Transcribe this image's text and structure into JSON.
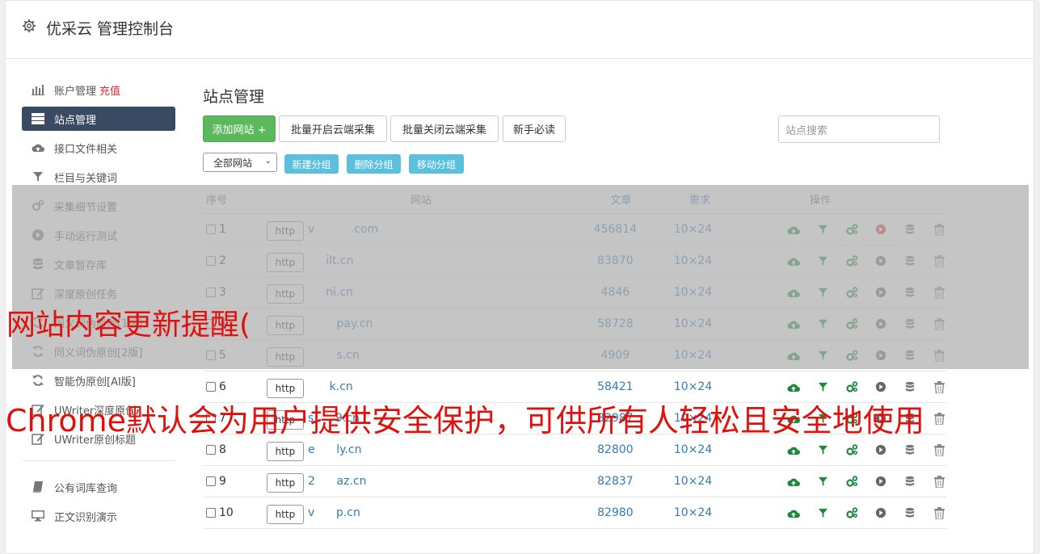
{
  "header": {
    "title": "优采云 管理控制台"
  },
  "sidebar": {
    "items": [
      {
        "icon": "bar-chart-icon",
        "label": "账户管理",
        "extra": "充值"
      },
      {
        "icon": "server-icon",
        "label": "站点管理",
        "active": true
      },
      {
        "icon": "cloud-upload-icon",
        "label": "接口文件相关"
      },
      {
        "icon": "filter-icon",
        "label": "栏目与关键词"
      },
      {
        "icon": "cogs-icon",
        "label": "采集细节设置"
      },
      {
        "icon": "play-circle-icon",
        "label": "手动运行测试"
      },
      {
        "icon": "database-icon",
        "label": "文章暂存库"
      },
      {
        "icon": "edit-icon",
        "label": "深度原创任务"
      },
      {
        "icon": "refresh-icon",
        "label": "同义词伪原创[1版]"
      },
      {
        "icon": "refresh-icon",
        "label": "同义词伪原创[2版]"
      },
      {
        "icon": "refresh-icon",
        "label": "智能伪原创[AI版]"
      },
      {
        "icon": "edit-icon",
        "label": "UWriter深度原创"
      },
      {
        "icon": "edit-icon",
        "label": "UWriter原创标题"
      }
    ],
    "items_after_divider": [
      {
        "icon": "book-icon",
        "label": "公有词库查询"
      },
      {
        "icon": "monitor-icon",
        "label": "正文识别演示"
      }
    ]
  },
  "main": {
    "title": "站点管理",
    "add_site_label": "添加网站 +",
    "batch_enable_label": "批量开启云端采集",
    "batch_disable_label": "批量关闭云端采集",
    "newbie_label": "新手必读",
    "search_placeholder": "站点搜索",
    "group_select": "全部网站",
    "new_group_label": "新建分组",
    "delete_group_label": "删除分组",
    "move_group_label": "移动分组",
    "table": {
      "headers": {
        "idx": "序号",
        "site": "网站",
        "articles": "文章",
        "demand": "需求",
        "ops": "操作"
      },
      "rows": [
        {
          "idx": "1",
          "proto": "http",
          "site": "v          .com",
          "articles": "456814",
          "demand": "10×24",
          "play_active": true
        },
        {
          "idx": "2",
          "proto": "http",
          "site": "     ilt.cn",
          "articles": "83870",
          "demand": "10×24"
        },
        {
          "idx": "3",
          "proto": "http",
          "site": "     ni.cn",
          "articles": "4846",
          "demand": "10×24"
        },
        {
          "idx": "4",
          "proto": "http",
          "site": "        pay.cn",
          "articles": "58728",
          "demand": "10×24"
        },
        {
          "idx": "5",
          "proto": "http",
          "site": "        s.cn",
          "articles": "4909",
          "demand": "10×24"
        },
        {
          "idx": "6",
          "proto": "http",
          "site": "      k.cn",
          "articles": "58421",
          "demand": "10×24"
        },
        {
          "idx": "7",
          "proto": "http",
          "site": "s      9.cn",
          "articles": "82987",
          "demand": "10×24"
        },
        {
          "idx": "8",
          "proto": "http",
          "site": "e      ly.cn",
          "articles": "82800",
          "demand": "10×24"
        },
        {
          "idx": "9",
          "proto": "http",
          "site": "2      az.cn",
          "articles": "82837",
          "demand": "10×24"
        },
        {
          "idx": "10",
          "proto": "http",
          "site": "v      p.cn",
          "articles": "82980",
          "demand": "10×24"
        }
      ]
    }
  },
  "watermark": {
    "line1": "网站内容更新提醒(",
    "line2": "Chrome默认会为用户提供安全保护，可供所有人轻松且安全地使用"
  },
  "colors": {
    "green": "#5cb85c",
    "info": "#5bc0de",
    "sidebar_active": "#3a4a63",
    "watermark": "#e0100c",
    "link": "#337ab7"
  }
}
